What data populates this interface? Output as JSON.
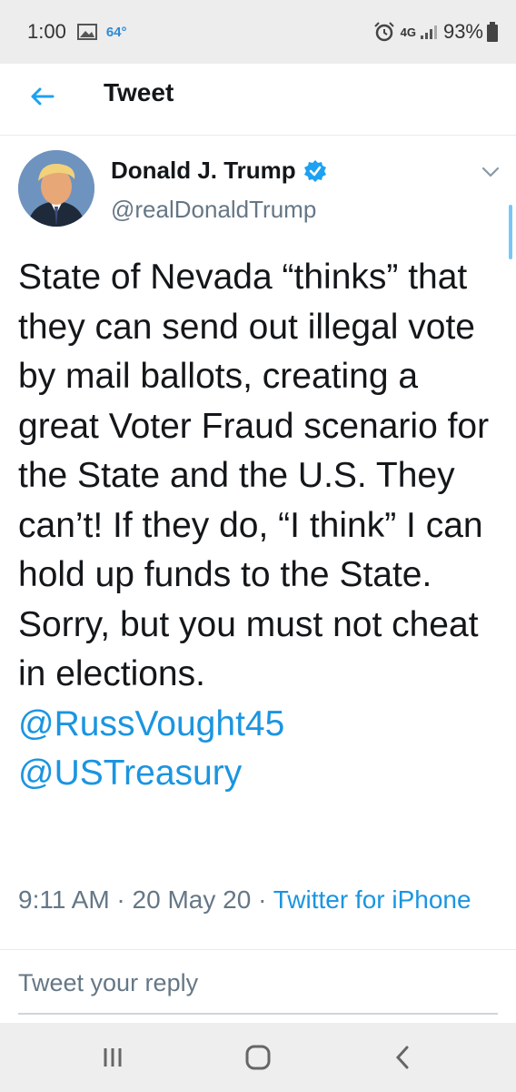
{
  "status_bar": {
    "time": "1:00",
    "temperature": "64°",
    "network": "4G",
    "battery": "93%",
    "icons": [
      "image-icon",
      "alarm-icon",
      "signal-icon",
      "battery-icon"
    ]
  },
  "header": {
    "title": "Tweet",
    "back_icon": "arrow-left-icon"
  },
  "author": {
    "name": "Donald J. Trump",
    "handle": "@realDonaldTrump",
    "verified": true
  },
  "tweet": {
    "text": "State of Nevada “thinks” that they can send out illegal vote by mail ballots, creating a great Voter Fraud scenario for the State and the U.S. They can’t! If they do, “I think” I can hold up funds to the State. Sorry, but you must not cheat in elections.",
    "mentions": [
      "@RussVought45",
      "@USTreasury"
    ],
    "time": "9:11 AM",
    "separator": " · ",
    "date": "20 May 20",
    "source": "Twitter for iPhone"
  },
  "reply": {
    "placeholder": "Tweet your reply"
  },
  "colors": {
    "accent": "#1da1f2",
    "link": "#1b95e0",
    "text": "#14171a",
    "secondary": "#657786"
  }
}
